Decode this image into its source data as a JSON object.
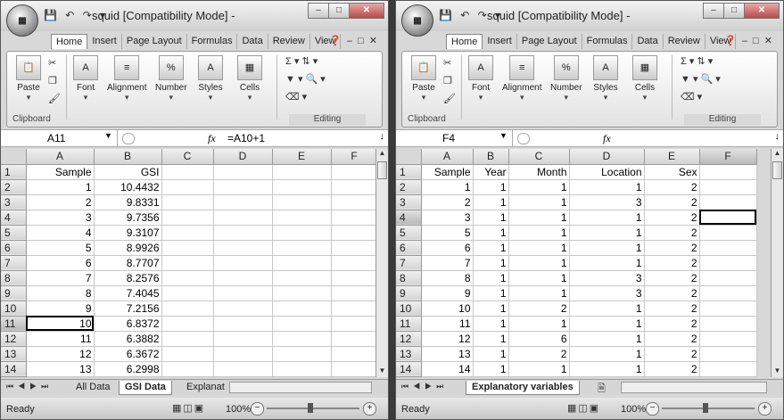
{
  "windows": [
    {
      "title": "squid  [Compatibility Mode] -",
      "ribbon_tabs": [
        "Home",
        "Insert",
        "Page Layout",
        "Formulas",
        "Data",
        "Review",
        "View"
      ],
      "groups": {
        "paste": "Paste",
        "font": "Font",
        "alignment": "Alignment",
        "number": "Number",
        "styles": "Styles",
        "cells": "Cells",
        "clipboard": "Clipboard",
        "editing": "Editing"
      },
      "name_box": "A11",
      "formula": "=A10+1",
      "columns": [
        "A",
        "B",
        "C",
        "D",
        "E",
        "F"
      ],
      "rows": [
        [
          "1",
          "Sample",
          "GSI",
          "",
          "",
          "",
          ""
        ],
        [
          "2",
          "1",
          "10.4432",
          "",
          "",
          "",
          ""
        ],
        [
          "3",
          "2",
          "9.8331",
          "",
          "",
          "",
          ""
        ],
        [
          "4",
          "3",
          "9.7356",
          "",
          "",
          "",
          ""
        ],
        [
          "5",
          "4",
          "9.3107",
          "",
          "",
          "",
          ""
        ],
        [
          "6",
          "5",
          "8.9926",
          "",
          "",
          "",
          ""
        ],
        [
          "7",
          "6",
          "8.7707",
          "",
          "",
          "",
          ""
        ],
        [
          "8",
          "7",
          "8.2576",
          "",
          "",
          "",
          ""
        ],
        [
          "9",
          "8",
          "7.4045",
          "",
          "",
          "",
          ""
        ],
        [
          "10",
          "9",
          "7.2156",
          "",
          "",
          "",
          ""
        ],
        [
          "11",
          "10",
          "6.8372",
          "",
          "",
          "",
          ""
        ],
        [
          "12",
          "11",
          "6.3882",
          "",
          "",
          "",
          ""
        ],
        [
          "13",
          "12",
          "6.3672",
          "",
          "",
          "",
          ""
        ],
        [
          "14",
          "13",
          "6.2998",
          "",
          "",
          "",
          ""
        ]
      ],
      "sheet_tabs": [
        "All Data",
        "GSI Data",
        "Explanat"
      ],
      "status": "Ready",
      "zoom": "100%"
    },
    {
      "title": "squid  [Compatibility Mode] -",
      "ribbon_tabs": [
        "Home",
        "Insert",
        "Page Layout",
        "Formulas",
        "Data",
        "Review",
        "View"
      ],
      "groups": {
        "paste": "Paste",
        "font": "Font",
        "alignment": "Alignment",
        "number": "Number",
        "styles": "Styles",
        "cells": "Cells",
        "clipboard": "Clipboard",
        "editing": "Editing"
      },
      "name_box": "F4",
      "formula": "",
      "columns": [
        "A",
        "B",
        "C",
        "D",
        "E",
        "F"
      ],
      "rows": [
        [
          "1",
          "Sample",
          "Year",
          "Month",
          "Location",
          "Sex",
          ""
        ],
        [
          "2",
          "1",
          "1",
          "1",
          "1",
          "2",
          ""
        ],
        [
          "3",
          "2",
          "1",
          "1",
          "3",
          "2",
          ""
        ],
        [
          "4",
          "3",
          "1",
          "1",
          "1",
          "2",
          ""
        ],
        [
          "5",
          "5",
          "1",
          "1",
          "1",
          "2",
          ""
        ],
        [
          "6",
          "6",
          "1",
          "1",
          "1",
          "2",
          ""
        ],
        [
          "7",
          "7",
          "1",
          "1",
          "1",
          "2",
          ""
        ],
        [
          "8",
          "8",
          "1",
          "1",
          "3",
          "2",
          ""
        ],
        [
          "9",
          "9",
          "1",
          "1",
          "3",
          "2",
          ""
        ],
        [
          "10",
          "10",
          "1",
          "2",
          "1",
          "2",
          ""
        ],
        [
          "11",
          "11",
          "1",
          "1",
          "1",
          "2",
          ""
        ],
        [
          "12",
          "12",
          "1",
          "6",
          "1",
          "2",
          ""
        ],
        [
          "13",
          "13",
          "1",
          "2",
          "1",
          "2",
          ""
        ],
        [
          "14",
          "14",
          "1",
          "1",
          "1",
          "2",
          ""
        ]
      ],
      "sheet_tabs": [
        "Explanatory variables"
      ],
      "status": "Ready",
      "zoom": "100%"
    }
  ]
}
